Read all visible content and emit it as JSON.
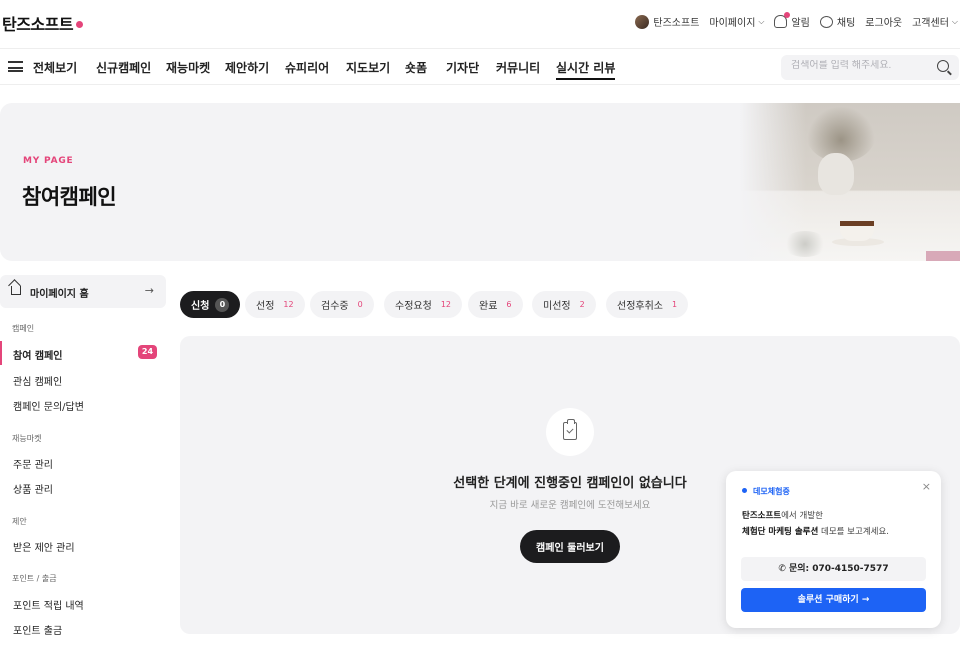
{
  "header": {
    "logo": "탄즈소프트",
    "util": {
      "user": "탄즈소프트",
      "mypage": "마이페이지",
      "alarm": "알림",
      "chat": "채팅",
      "logout": "로그아웃",
      "support": "고객센터"
    }
  },
  "nav": {
    "menu_label": "전체보기",
    "items": [
      "신규캠페인",
      "재능마켓",
      "제안하기",
      "슈피리어",
      "지도보기",
      "숏폼",
      "기자단",
      "커뮤니티",
      "실시간 리뷰"
    ],
    "active": "실시간 리뷰",
    "search_placeholder": "검색어를 입력 해주세요."
  },
  "banner": {
    "kicker": "MY PAGE",
    "title": "참여캠페인"
  },
  "sidebar": {
    "home": "마이페이지 홈",
    "sections": [
      {
        "title": "캠페인",
        "items": [
          "참여 캠페인",
          "관심 캠페인",
          "캠페인 문의/답변"
        ]
      },
      {
        "title": "재능마켓",
        "items": [
          "주문 관리",
          "상품 관리"
        ]
      },
      {
        "title": "제안",
        "items": [
          "받은 제안 관리"
        ]
      },
      {
        "title": "포인트 / 출금",
        "items": [
          "포인트 적립 내역",
          "포인트 출금"
        ]
      }
    ],
    "active_item": "참여 캠페인",
    "active_badge": "24"
  },
  "tabs": [
    {
      "label": "신청",
      "count": "0",
      "active": true
    },
    {
      "label": "선정",
      "count": "12"
    },
    {
      "label": "검수중",
      "count": "0"
    },
    {
      "label": "수정요청",
      "count": "12"
    },
    {
      "label": "완료",
      "count": "6"
    },
    {
      "label": "미선정",
      "count": "2"
    },
    {
      "label": "선정후취소",
      "count": "1"
    }
  ],
  "empty": {
    "title": "선택한 단계에 진행중인 캠페인이 없습니다",
    "subtitle": "지금 바로 새로운 캠페인에 도전해보세요",
    "button": "캠페인 둘러보기"
  },
  "demo_popup": {
    "tag": "데모체험중",
    "line1_bold": "탄즈소프트",
    "line1_rest": "에서 개발한",
    "line2_bold": "체험단 마케팅 솔루션",
    "line2_rest": " 데모를 보고계세요.",
    "phone": "문의: 070-4150-7577",
    "buy": "솔루션 구매하기 →",
    "close": "×"
  },
  "colors": {
    "accent": "#e4457a",
    "primary_blue": "#1d63f5",
    "dark": "#1c1c1e",
    "surface": "#f3f3f5"
  }
}
